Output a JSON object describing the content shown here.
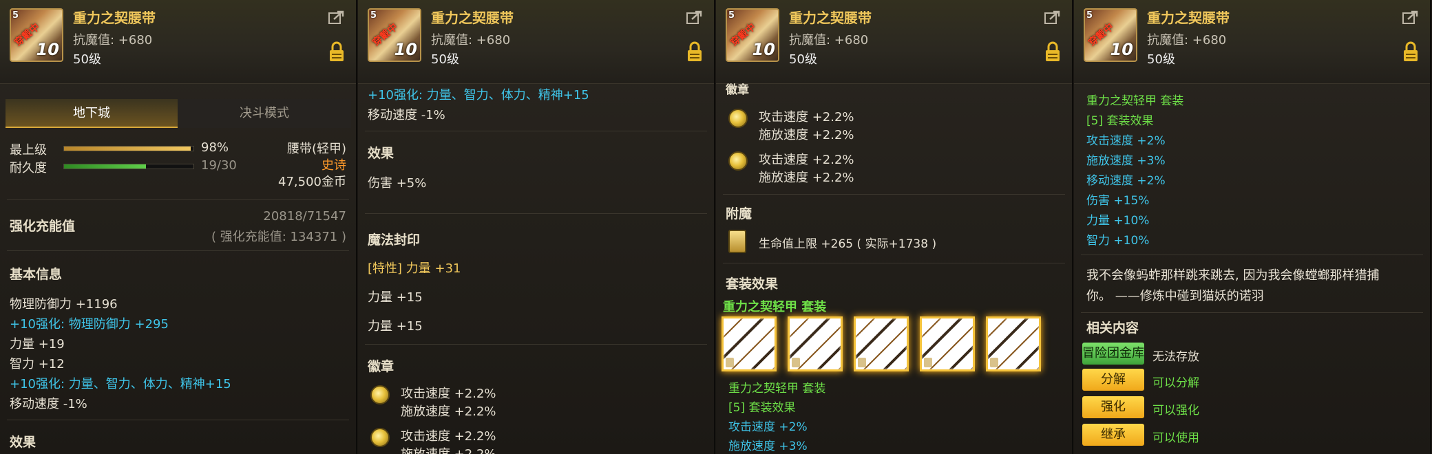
{
  "item": {
    "name": "重力之契腰带",
    "stat": "抗魔值: +680",
    "level": "50级",
    "grade_badge": "5",
    "stamp": "穿戴中",
    "upgrade": "10"
  },
  "panel1": {
    "tabs": [
      "地下城",
      "决斗模式"
    ],
    "max_level_label": "最上级",
    "max_level_pct": "98%",
    "max_level_fill": 0.98,
    "durability_label": "耐久度",
    "durability_value": "19/30",
    "durability_fill": 0.633,
    "type": "腰带(轻甲)",
    "rarity": "史诗",
    "price": "47,500金币",
    "charge_label": "强化充能值",
    "charge_value": "20818/71547",
    "charge_sub": "( 强化充能值: 134371 )",
    "basic_info": "基本信息",
    "lines": [
      {
        "text": "物理防御力 +1196",
        "color": "white"
      },
      {
        "text": "+10强化: 物理防御力 +295",
        "color": "cyan"
      },
      {
        "text": "力量 +19",
        "color": "white"
      },
      {
        "text": "智力 +12",
        "color": "white"
      },
      {
        "text": "+10强化: 力量、智力、体力、精神+15",
        "color": "cyan"
      },
      {
        "text": "移动速度 -1%",
        "color": "white"
      }
    ],
    "effect_head": "效果"
  },
  "panel2": {
    "top_line1": "+10强化: 力量、智力、体力、精神+15",
    "top_line2": "移动速度 -1%",
    "effect_head": "效果",
    "effect_line": "伤害 +5%",
    "seal_head": "魔法封印",
    "seal_lines": [
      "[特性] 力量 +31",
      "力量 +15",
      "力量 +15"
    ],
    "emblem_head": "徽章",
    "emblem1_a": "攻击速度 +2.2%",
    "emblem1_b": "施放速度 +2.2%",
    "emblem2_a": "攻击速度 +2.2%",
    "emblem2_b": "施放速度 +2.2%"
  },
  "panel3": {
    "top_partial": "徽章",
    "emblem1_a": "攻击速度 +2.2%",
    "emblem1_b": "施放速度 +2.2%",
    "emblem2_a": "攻击速度 +2.2%",
    "emblem2_b": "施放速度 +2.2%",
    "enchant_head": "附魔",
    "enchant_line": "生命值上限 +265 ( 实际+1738 )",
    "set_head": "套装效果",
    "set_name": "重力之契轻甲 套装",
    "set_name2": "重力之契轻甲 套装",
    "set_effect": "[5] 套装效果",
    "set_lines": [
      "攻击速度 +2%",
      "施放速度 +3%"
    ]
  },
  "panel4": {
    "set_name": "重力之契轻甲 套装",
    "set_effect": "[5] 套装效果",
    "set_lines": [
      "攻击速度 +2%",
      "施放速度 +3%",
      "移动速度 +2%",
      "伤害 +15%",
      "力量 +10%",
      "智力 +10%"
    ],
    "flavor1": "我不会像蚂蚱那样跳来跳去, 因为我会像螳螂那样猎捕",
    "flavor2": "你。 ——修炼中碰到猫妖的诺羽",
    "related_head": "相关内容",
    "actions": [
      {
        "button": "冒险团金库",
        "status": "无法存放"
      },
      {
        "button": "分解",
        "status": "可以分解"
      },
      {
        "button": "强化",
        "status": "可以强化"
      },
      {
        "button": "继承",
        "status": "可以使用"
      }
    ]
  }
}
